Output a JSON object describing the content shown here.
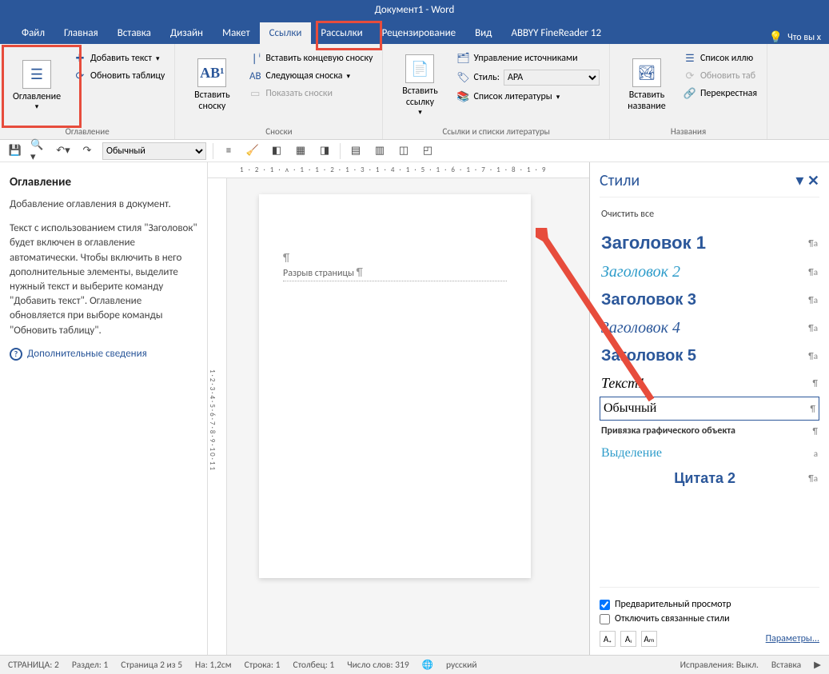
{
  "title": "Документ1 - Word",
  "tabs": {
    "file": "Файл",
    "home": "Главная",
    "insert": "Вставка",
    "design": "Дизайн",
    "layout": "Макет",
    "references": "Ссылки",
    "mailings": "Рассылки",
    "review": "Рецензирование",
    "view": "Вид",
    "abbyy": "ABBYY FineReader 12",
    "tellme": "Что вы х"
  },
  "ribbon": {
    "toc": {
      "button": "Оглавление",
      "add_text": "Добавить текст",
      "update": "Обновить таблицу",
      "group": "Оглавление"
    },
    "footnotes": {
      "insert": "Вставить сноску",
      "endnote": "Вставить концевую сноску",
      "next": "Следующая сноска",
      "show": "Показать сноски",
      "group": "Сноски"
    },
    "citations": {
      "insert": "Вставить ссылку",
      "manage": "Управление источниками",
      "style_label": "Стиль:",
      "style_value": "APA",
      "biblio": "Список литературы",
      "group": "Ссылки и списки литературы"
    },
    "captions": {
      "insert": "Вставить название",
      "list": "Список иллю",
      "update": "Обновить таб",
      "cross": "Перекрестная",
      "group": "Названия"
    }
  },
  "qat": {
    "style_select": "Обычный"
  },
  "tooltip": {
    "title": "Оглавление",
    "p1": "Добавление оглавления в документ.",
    "p2": "Текст с использованием стиля \"Заголовок\" будет включен в оглавление автоматически. Чтобы включить в него дополнительные элементы, выделите нужный текст и выберите команду \"Добавить текст\". Оглавление обновляется при выборе команды \"Обновить таблицу\".",
    "more": "Дополнительные сведения"
  },
  "doc": {
    "page_break": "Разрыв страницы"
  },
  "styles_pane": {
    "title": "Стили",
    "clear": "Очистить все",
    "items": {
      "h1": "Заголовок 1",
      "h2": "Заголовок 2",
      "h3": "Заголовок 3",
      "h4": "Заголовок 4",
      "h5": "Заголовок 5",
      "text1": "Текст1",
      "normal": "Обычный",
      "anchor": "Привязка графического объекта",
      "highlight": "Выделение",
      "quote": "Цитата 2"
    },
    "preview": "Предварительный просмотр",
    "disable_linked": "Отключить связанные стили",
    "params": "Параметры..."
  },
  "status": {
    "page": "СТРАНИЦА: 2",
    "section": "Раздел: 1",
    "page_of": "Страница 2 из 5",
    "at": "На: 1,2см",
    "line": "Строка: 1",
    "column": "Столбец: 1",
    "words": "Число слов: 319",
    "lang": "русский",
    "track": "Исправления: Выкл.",
    "insert": "Вставка"
  }
}
